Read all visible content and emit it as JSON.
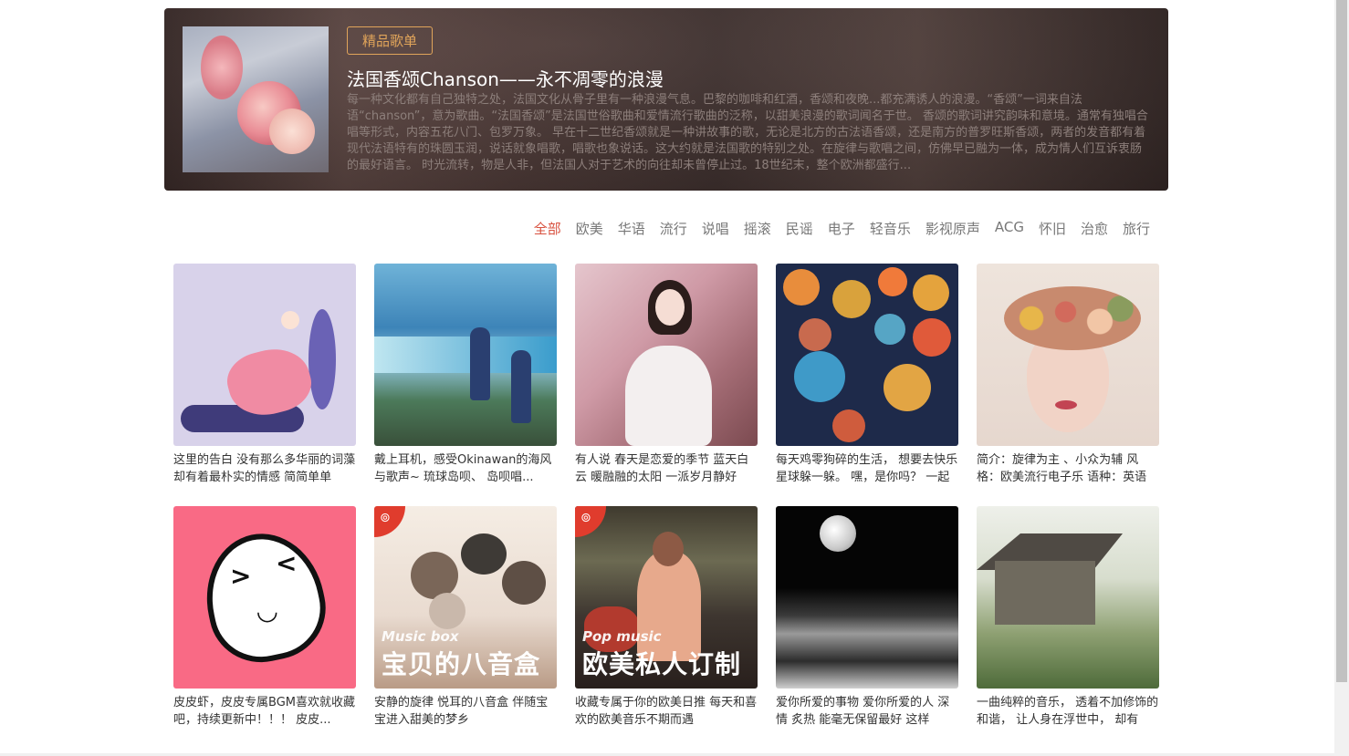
{
  "banner": {
    "tag": "精品歌单",
    "title": "法国香颂Chanson——永不凋零的浪漫",
    "description": "每一种文化都有自己独特之处，法国文化从骨子里有一种浪漫气息。巴黎的咖啡和红酒，香颂和夜晚...都充满诱人的浪漫。“香颂”一词来自法语“chanson”，意为歌曲。“法国香颂”是法国世俗歌曲和爱情流行歌曲的泛称，以甜美浪漫的歌词闻名于世。 香颂的歌词讲究韵味和意境。通常有独唱合唱等形式，内容五花八门、包罗万象。 早在十二世纪香颂就是一种讲故事的歌，无论是北方的古法语香颂，还是南方的普罗旺斯香颂，两者的发音都有着现代法语特有的珠圆玉润，说话就象唱歌，唱歌也象说话。这大约就是法国歌的特别之处。在旋律与歌唱之间，仿佛早已融为一体，成为情人们互诉衷肠的最好语言。 时光流转，物是人非，但法国人对于艺术的向往却未曾停止过。18世纪末，整个欧洲都盛行..."
  },
  "tabs": [
    {
      "label": "全部",
      "active": true
    },
    {
      "label": "欧美"
    },
    {
      "label": "华语"
    },
    {
      "label": "流行"
    },
    {
      "label": "说唱"
    },
    {
      "label": "摇滚"
    },
    {
      "label": "民谣"
    },
    {
      "label": "电子"
    },
    {
      "label": "轻音乐"
    },
    {
      "label": "影视原声"
    },
    {
      "label": "ACG"
    },
    {
      "label": "怀旧"
    },
    {
      "label": "治愈"
    },
    {
      "label": "旅行"
    }
  ],
  "playlists": [
    {
      "title": "这里的告白 没有那么多华丽的词藻 却有着最朴实的情感 简简单单"
    },
    {
      "title": "戴上耳机，感受Okinawan的海风与歌声~ 琉球岛呗、 岛呗唱..."
    },
    {
      "title": "有人说 春天是恋爱的季节 蓝天白云 暖融融的太阳 一派岁月静好"
    },
    {
      "title": "每天鸡零狗碎的生活， 想要去快乐星球躲一躲。 嘿，是你吗？ 一起"
    },
    {
      "title": "简介：旋律为主 、小众为辅 风格：欧美流行电子乐 语种：英语"
    },
    {
      "title": "皮皮虾，皮皮专属BGM喜欢就收藏吧，持续更新中！！！ 皮皮..."
    },
    {
      "title": "安静的旋律 悦耳的八音盒 伴随宝宝进入甜美的梦乡"
    },
    {
      "title": "收藏专属于你的欧美日推 每天和喜欢的欧美音乐不期而遇"
    },
    {
      "title": "爱你所爱的事物 爱你所爱的人 深情 炙热 能毫无保留最好 这样"
    },
    {
      "title": "一曲纯粹的音乐， 透着不加修饰的和谐， 让人身在浮世中， 却有"
    }
  ],
  "cover_overlays": {
    "music_box": {
      "en": "Music box",
      "zh": "宝贝的八音盒",
      "badge_icon": "netease-logo-icon"
    },
    "pop_music": {
      "en": "Pop music",
      "zh": "欧美私人订制",
      "badge_icon": "netease-logo-icon"
    }
  },
  "colors": {
    "accent": "#d8513f",
    "tag_gold": "#e0a45a"
  }
}
